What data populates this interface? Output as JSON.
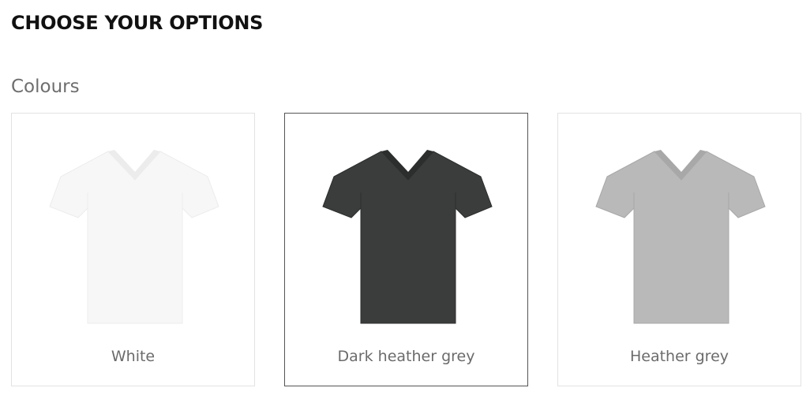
{
  "header": {
    "title": "CHOOSE YOUR OPTIONS"
  },
  "colours": {
    "label": "Colours",
    "options": [
      {
        "name": "White",
        "color": "#f7f7f7",
        "shade": "#ececec",
        "selected": false
      },
      {
        "name": "Dark heather grey",
        "color": "#3b3d3c",
        "shade": "#2c2e2d",
        "selected": true
      },
      {
        "name": "Heather grey",
        "color": "#b9b9b9",
        "shade": "#a8a8a8",
        "selected": false
      }
    ]
  }
}
